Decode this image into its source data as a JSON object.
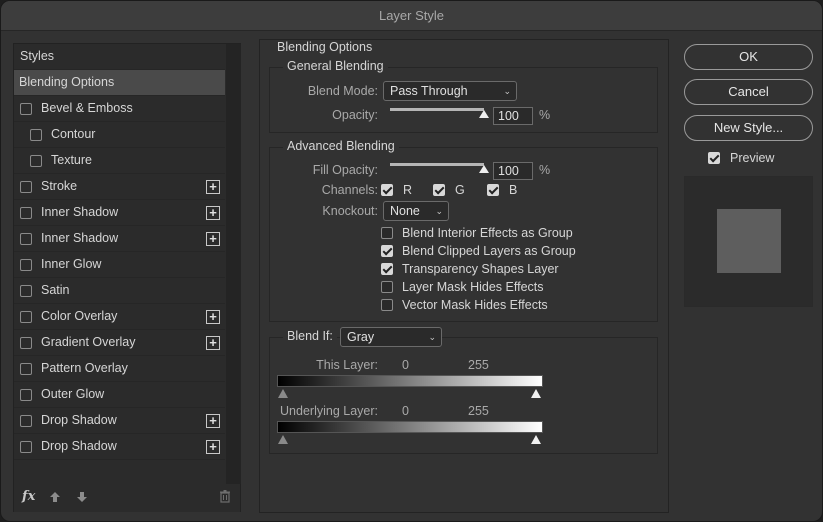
{
  "window": {
    "title": "Layer Style"
  },
  "styles_panel": {
    "header": "Styles",
    "items": [
      {
        "label": "Blending Options",
        "selected": true,
        "checkbox": false,
        "indent": false,
        "plus": false
      },
      {
        "label": "Bevel & Emboss",
        "checkbox": true,
        "checked": false,
        "indent": false,
        "plus": false
      },
      {
        "label": "Contour",
        "checkbox": true,
        "checked": false,
        "indent": true,
        "plus": false
      },
      {
        "label": "Texture",
        "checkbox": true,
        "checked": false,
        "indent": true,
        "plus": false
      },
      {
        "label": "Stroke",
        "checkbox": true,
        "checked": false,
        "indent": false,
        "plus": true
      },
      {
        "label": "Inner Shadow",
        "checkbox": true,
        "checked": false,
        "indent": false,
        "plus": true
      },
      {
        "label": "Inner Shadow",
        "checkbox": true,
        "checked": false,
        "indent": false,
        "plus": true
      },
      {
        "label": "Inner Glow",
        "checkbox": true,
        "checked": false,
        "indent": false,
        "plus": false
      },
      {
        "label": "Satin",
        "checkbox": true,
        "checked": false,
        "indent": false,
        "plus": false
      },
      {
        "label": "Color Overlay",
        "checkbox": true,
        "checked": false,
        "indent": false,
        "plus": true
      },
      {
        "label": "Gradient Overlay",
        "checkbox": true,
        "checked": false,
        "indent": false,
        "plus": true
      },
      {
        "label": "Pattern Overlay",
        "checkbox": true,
        "checked": false,
        "indent": false,
        "plus": false
      },
      {
        "label": "Outer Glow",
        "checkbox": true,
        "checked": false,
        "indent": false,
        "plus": false
      },
      {
        "label": "Drop Shadow",
        "checkbox": true,
        "checked": false,
        "indent": false,
        "plus": true
      },
      {
        "label": "Drop Shadow",
        "checkbox": true,
        "checked": false,
        "indent": false,
        "plus": true
      }
    ],
    "footer": {
      "fx_label": "fx",
      "move_up_icon": "arrow-up-icon",
      "move_down_icon": "arrow-down-icon",
      "delete_icon": "trash-icon"
    }
  },
  "blending_options": {
    "title": "Blending Options",
    "general": {
      "title": "General Blending",
      "blend_mode_label": "Blend Mode:",
      "blend_mode_value": "Pass Through",
      "opacity_label": "Opacity:",
      "opacity_value": "100",
      "opacity_percent": 100,
      "percent_sign": "%"
    },
    "advanced": {
      "title": "Advanced Blending",
      "fill_opacity_label": "Fill Opacity:",
      "fill_opacity_value": "100",
      "fill_opacity_percent": 100,
      "percent_sign": "%",
      "channels_label": "Channels:",
      "channel_r": "R",
      "channel_g": "G",
      "channel_b": "B",
      "knockout_label": "Knockout:",
      "knockout_value": "None",
      "options": [
        {
          "label": "Blend Interior Effects as Group",
          "checked": false
        },
        {
          "label": "Blend Clipped Layers as Group",
          "checked": true
        },
        {
          "label": "Transparency Shapes Layer",
          "checked": true
        },
        {
          "label": "Layer Mask Hides Effects",
          "checked": false
        },
        {
          "label": "Vector Mask Hides Effects",
          "checked": false
        }
      ]
    },
    "blend_if": {
      "label": "Blend If:",
      "value": "Gray",
      "this_layer_label": "This Layer:",
      "this_layer_min": "0",
      "this_layer_max": "255",
      "underlying_label": "Underlying Layer:",
      "underlying_min": "0",
      "underlying_max": "255"
    }
  },
  "buttons": {
    "ok": "OK",
    "cancel": "Cancel",
    "new_style": "New Style..."
  },
  "preview": {
    "label": "Preview",
    "checked": true
  }
}
